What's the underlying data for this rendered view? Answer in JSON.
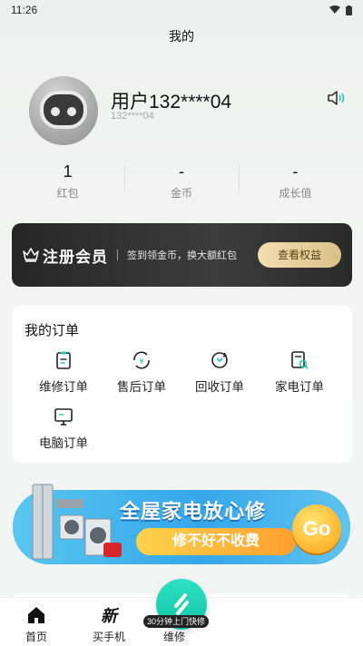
{
  "status_bar": {
    "time": "11:26"
  },
  "header": {
    "title": "我的"
  },
  "profile": {
    "name": "用户132****04",
    "phone": "132****04"
  },
  "stats": [
    {
      "value": "1",
      "label": "红包"
    },
    {
      "value": "-",
      "label": "金币"
    },
    {
      "value": "-",
      "label": "成长值"
    }
  ],
  "vip": {
    "title": "注册会员",
    "desc": "签到领金币，换大额红包",
    "button": "查看权益"
  },
  "orders": {
    "title": "我的订单",
    "items": [
      {
        "label": "维修订单",
        "icon": "clipboard-icon"
      },
      {
        "label": "售后订单",
        "icon": "yuan-refresh-icon"
      },
      {
        "label": "回收订单",
        "icon": "recycle-icon"
      },
      {
        "label": "家电订单",
        "icon": "appliance-search-icon"
      },
      {
        "label": "电脑订单",
        "icon": "monitor-icon"
      }
    ]
  },
  "banner": {
    "title": "全屋家电放心修",
    "pill": "修不好不收费",
    "go": "Go"
  },
  "tabbar": {
    "home": "首页",
    "buy": "买手机",
    "repair": "维修",
    "repair_badge": "30分钟上门快修"
  },
  "colors": {
    "accent": "#1ec9ad",
    "vip_gold": "#e2c791",
    "banner_blue": "#3aa9ea"
  }
}
